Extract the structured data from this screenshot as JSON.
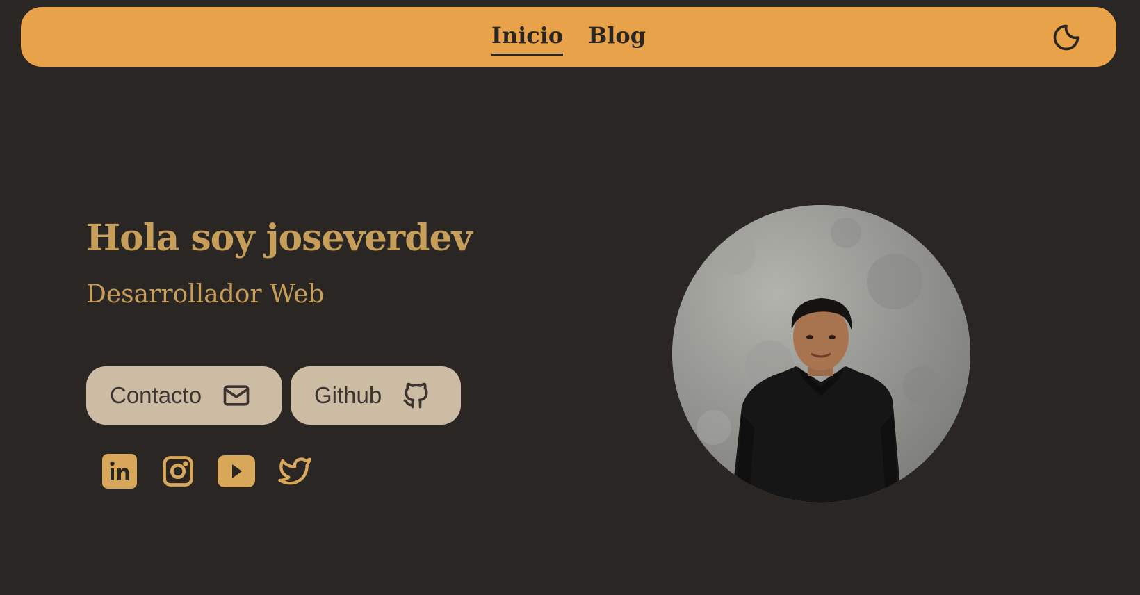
{
  "nav": {
    "links": [
      {
        "label": "Inicio",
        "active": true
      },
      {
        "label": "Blog",
        "active": false
      }
    ],
    "theme_icon": "moon-icon"
  },
  "hero": {
    "title": "Hola soy joseverdev",
    "subtitle": "Desarrollador Web"
  },
  "buttons": {
    "contact": {
      "label": "Contacto",
      "icon": "mail-icon"
    },
    "github": {
      "label": "Github",
      "icon": "github-icon"
    }
  },
  "socials": [
    {
      "icon": "linkedin-icon"
    },
    {
      "icon": "instagram-icon"
    },
    {
      "icon": "youtube-icon"
    },
    {
      "icon": "twitter-icon"
    }
  ],
  "colors": {
    "background": "#2a2623",
    "navbar": "#e7a24a",
    "accent_text": "#c79d5a",
    "button_bg": "#cdbca4",
    "icon_gold": "#d8a75a"
  }
}
